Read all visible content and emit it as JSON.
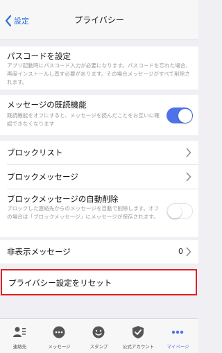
{
  "nav": {
    "back_label": "設定",
    "title": "プライバシー"
  },
  "passcode": {
    "title": "パスコードを設定",
    "description": "アプリ起動時にパスコード入力が必要になります。パスコードを忘れた場合、再度インストールし直す必要があります。その場合メッセージがすべて削除されます。"
  },
  "read_receipt": {
    "title": "メッセージの既読機能",
    "description": "既読機能をオフにすると、メッセージを読んだことをお互いに確認できなくなります",
    "enabled": true
  },
  "block_list": {
    "title": "ブロックリスト"
  },
  "block_messages": {
    "title": "ブロックメッセージ"
  },
  "auto_delete": {
    "title": "ブロックメッセージの自動削除",
    "description": "ブロックした連絡先からのメッセージを自動で削除します。オフの場合は「ブロックメッセージ」にメッセージが保存されます。",
    "enabled": false
  },
  "hidden_messages": {
    "title": "非表示メッセージ",
    "count": "0"
  },
  "reset": {
    "title": "プライバシー設定をリセット"
  },
  "colors": {
    "accent": "#4e72e8",
    "highlight": "#e02020"
  },
  "tabs": [
    {
      "label": "連絡先",
      "icon": "contacts-icon"
    },
    {
      "label": "メッセージ",
      "icon": "chat-bubble-icon"
    },
    {
      "label": "スタンプ",
      "icon": "smiley-icon"
    },
    {
      "label": "公式アカウント",
      "icon": "shield-check-icon"
    },
    {
      "label": "マイページ",
      "icon": "more-dots-icon",
      "active": true
    }
  ]
}
